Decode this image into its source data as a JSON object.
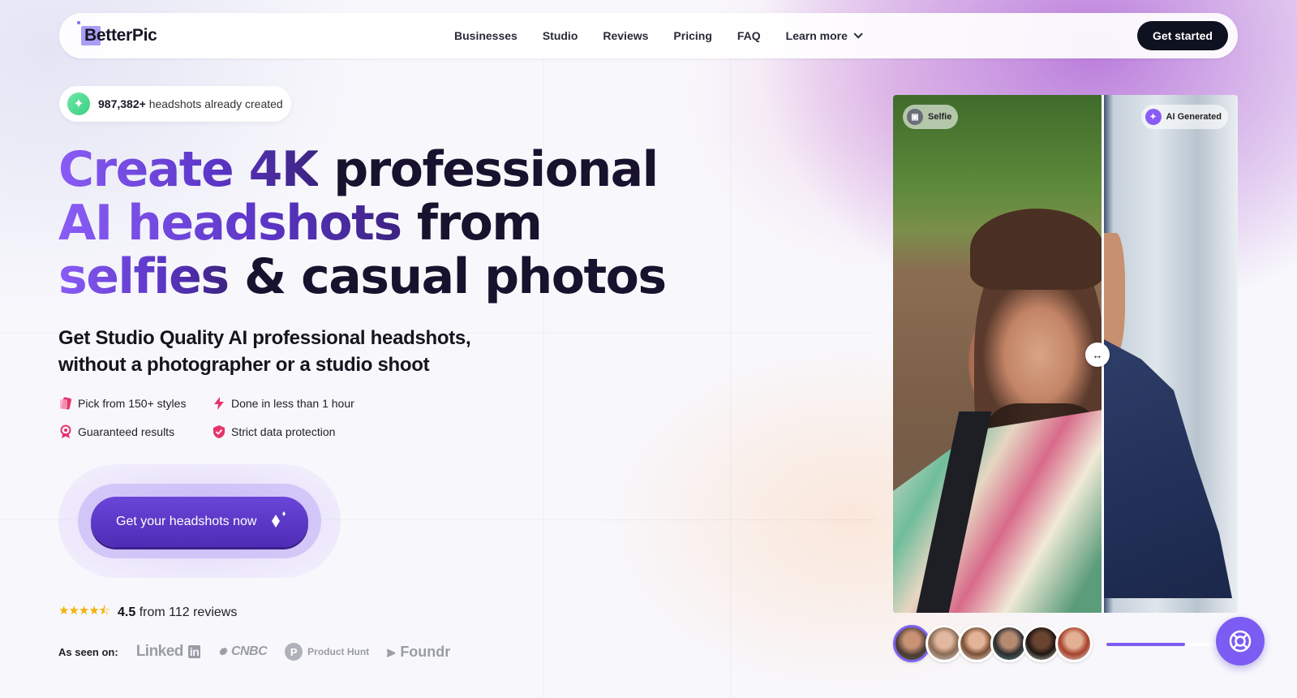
{
  "brand": {
    "name": "BetterPic"
  },
  "nav": {
    "links": [
      "Businesses",
      "Studio",
      "Reviews",
      "Pricing",
      "FAQ"
    ],
    "more_label": "Learn more",
    "cta_label": "Get started"
  },
  "badge": {
    "count": "987,382+",
    "text": "headshots already created"
  },
  "hero": {
    "line1_grad": "Create 4K",
    "line1_rest": " professional",
    "line2_grad": "AI headshots",
    "line2_rest": " from",
    "line3_grad": "selfies",
    "line3_rest": " & casual photos",
    "subtitle": "Get Studio Quality AI professional headshots, without a photographer or a studio shoot"
  },
  "features": [
    {
      "icon": "styles-card-icon",
      "label": "Pick from 150+ styles"
    },
    {
      "icon": "lightning-icon",
      "label": "Done in less than 1 hour"
    },
    {
      "icon": "award-ribbon-icon",
      "label": "Guaranteed results"
    },
    {
      "icon": "shield-check-icon",
      "label": "Strict data protection"
    }
  ],
  "cta": {
    "label": "Get your headshots now"
  },
  "rating": {
    "stars": 4.5,
    "stars_glyph": "★★★★⯪",
    "score": "4.5",
    "text": "from 112 reviews"
  },
  "press": {
    "label": "As seen on:",
    "linkedin_word": "Linked",
    "linkedin_box": "in",
    "cnbc": "CNBC",
    "producthunt_letter": "P",
    "producthunt": "Product Hunt",
    "foundr": "Foundr"
  },
  "compare": {
    "left_label": "Selfie",
    "right_label": "AI Generated",
    "handle_glyph": "↔"
  },
  "slider": {
    "progress": 0.69,
    "thumbnails": 6,
    "active_index": 0
  },
  "colors": {
    "accent": "#7c5cf2",
    "cta_gradient_start": "#6a45d9",
    "dark_button": "#0e1120",
    "badge_green": "#3ccf82",
    "feature_pink": "#e5336b",
    "star": "#f5b10a"
  }
}
